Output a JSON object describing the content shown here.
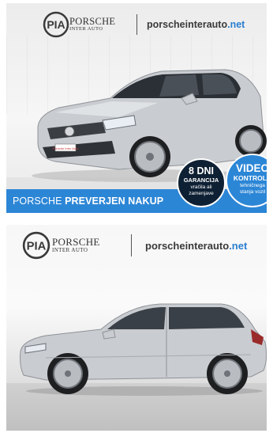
{
  "listing_images": [
    {
      "brand_line1": "PORSCHE",
      "brand_line2": "INTER AUTO",
      "site_name": "porscheinterauto",
      "site_tld": ".net",
      "plate_text": "Porsche Inter Auto",
      "banner_normal": "PORSCHE ",
      "banner_bold": "PREVERJEN NAKUP",
      "badge1_title": "8 DNI",
      "badge1_subtitle": "GARANCIJA",
      "badge1_line1": "vračila ali",
      "badge1_line2": "zamenjave",
      "badge2_title": "VIDEO",
      "badge2_subtitle": "KONTROLA",
      "badge2_line1": "tehničnega",
      "badge2_line2": "stanja vozil"
    },
    {
      "brand_line1": "PORSCHE",
      "brand_line2": "INTER AUTO",
      "site_name": "porscheinterauto",
      "site_tld": ".net"
    }
  ],
  "colors": {
    "accent_blue": "#2c86d6",
    "badge_dark": "#0e2033",
    "car_silver": "#c9ccd0"
  },
  "icons": [
    "porsche-inter-auto-logo-icon",
    "volkswagen-emblem-icon"
  ]
}
